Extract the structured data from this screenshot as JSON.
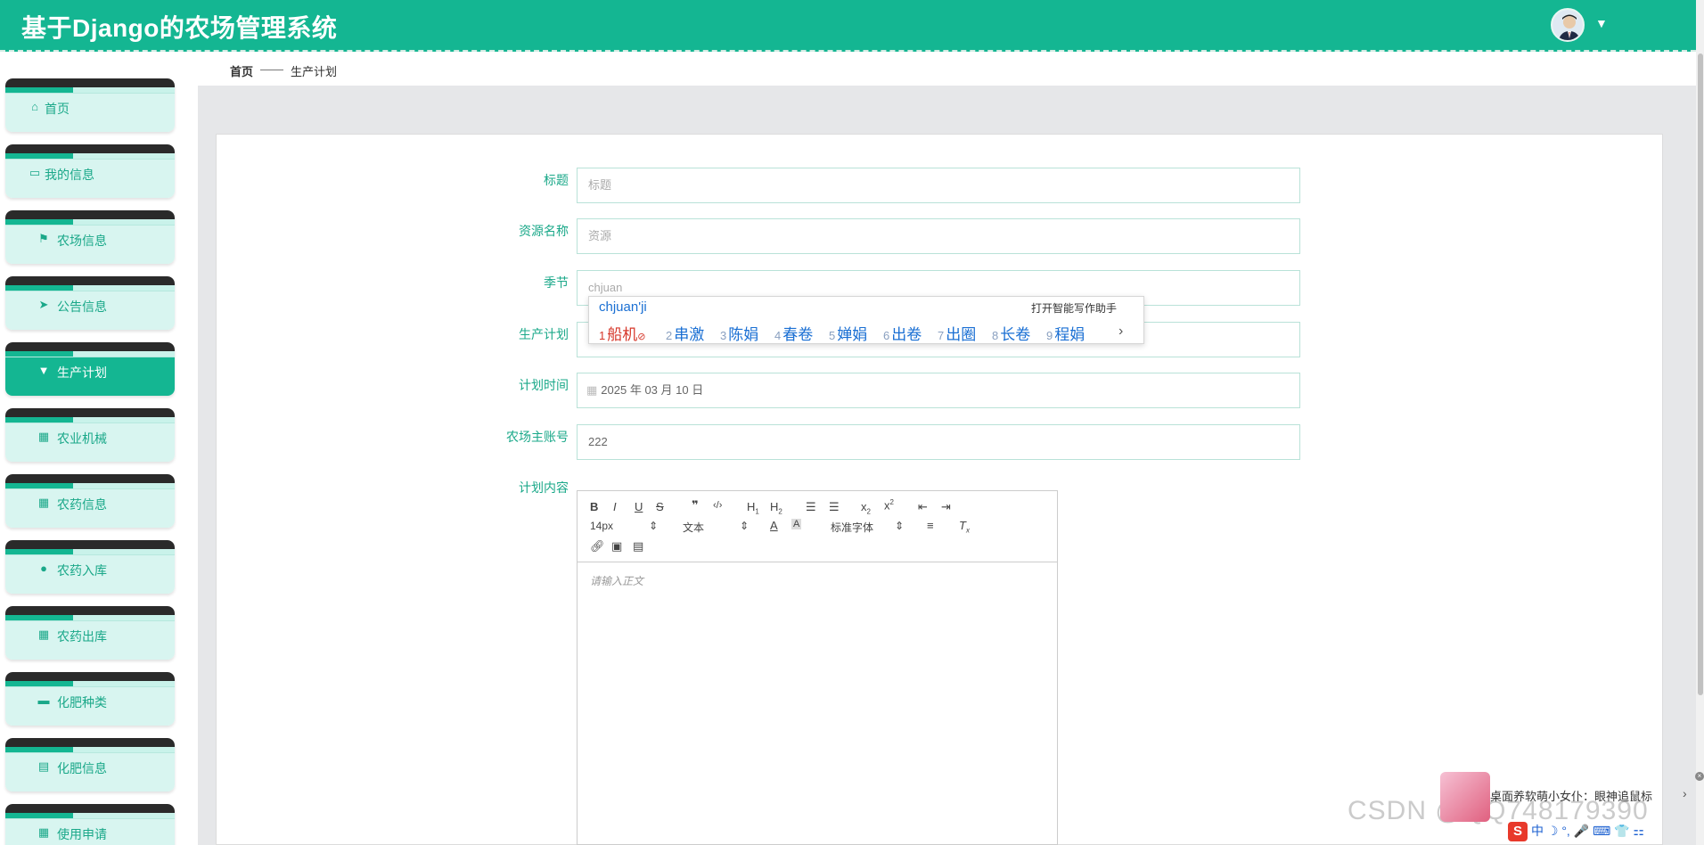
{
  "header": {
    "title": "基于Django的农场管理系统"
  },
  "sidebar": {
    "items": [
      {
        "label": "首页",
        "icon": "home-icon"
      },
      {
        "label": "我的信息",
        "icon": "card-icon"
      },
      {
        "label": "农场信息",
        "icon": "flag-icon"
      },
      {
        "label": "公告信息",
        "icon": "send-icon"
      },
      {
        "label": "生产计划",
        "icon": "brush-icon",
        "active": true
      },
      {
        "label": "农业机械",
        "icon": "grid-icon"
      },
      {
        "label": "农药信息",
        "icon": "grid-icon"
      },
      {
        "label": "农药入库",
        "icon": "user-icon"
      },
      {
        "label": "农药出库",
        "icon": "grid-icon"
      },
      {
        "label": "化肥种类",
        "icon": "ticket-icon"
      },
      {
        "label": "化肥信息",
        "icon": "clipboard-icon"
      },
      {
        "label": "使用申请",
        "icon": "grid-icon"
      }
    ]
  },
  "breadcrumb": {
    "home": "首页",
    "separator": "——",
    "current": "生产计划"
  },
  "form": {
    "title_label": "标题",
    "title_placeholder": "标题",
    "resource_label": "资源名称",
    "resource_placeholder": "资源",
    "season_label": "季节",
    "season_value": "chjuan",
    "plan_label": "生产计划",
    "plan_time_label": "计划时间",
    "plan_time_value": "2025 年 03 月 10 日",
    "account_label": "农场主账号",
    "account_value": "222",
    "content_label": "计划内容"
  },
  "editor": {
    "font_size": "14px",
    "block_type": "文本",
    "font_family": "标准字体",
    "placeholder": "请输入正文"
  },
  "ime": {
    "pinyin": "chjuan'ji",
    "assist": "打开智能写作助手",
    "candidates": [
      "船机",
      "串激",
      "陈娟",
      "春卷",
      "婵娟",
      "出卷",
      "出圈",
      "长卷",
      "程娟"
    ]
  },
  "overlay": {
    "pet_text": "桌面养软萌小女仆：眼神追鼠标",
    "watermark": "CSDN @QQ748179390",
    "ime_bar": "中 ☽ °, 🎤 ⌨ 👕 ⚏"
  },
  "colors": {
    "accent": "#14b692",
    "label": "#1aa889",
    "ime_blue": "#1a6fd3",
    "ime_red": "#d6372a"
  }
}
